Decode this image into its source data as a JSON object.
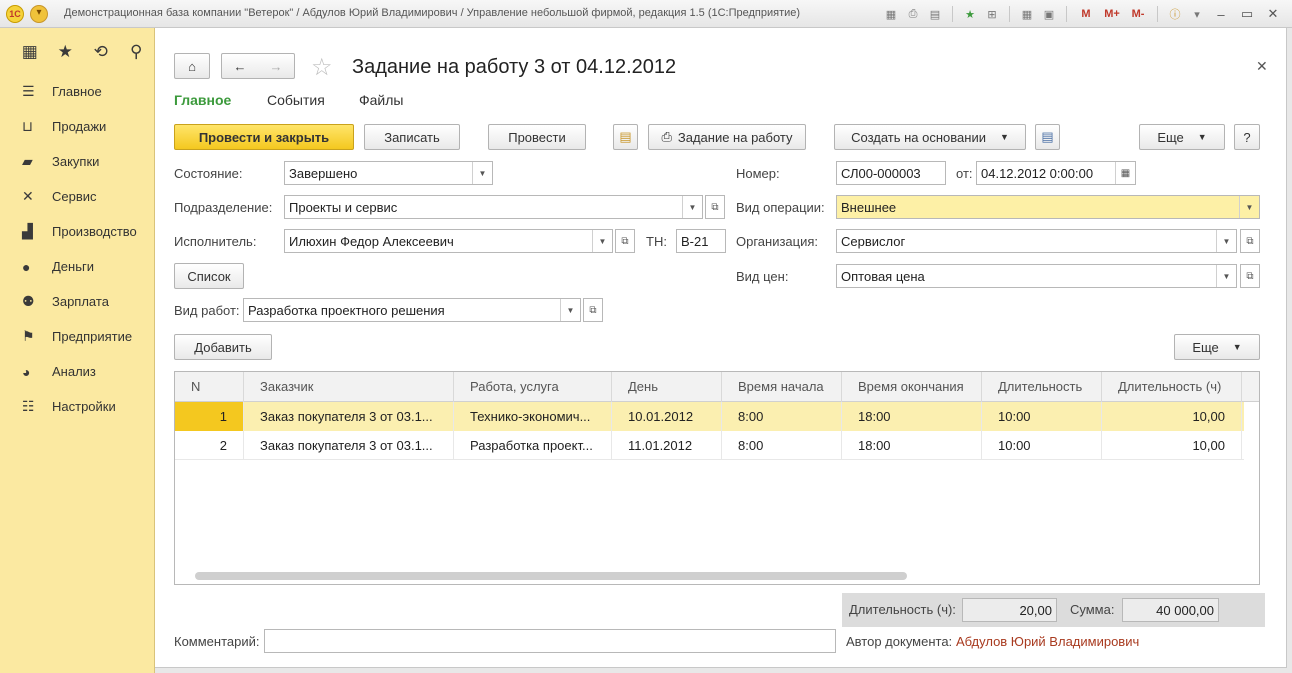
{
  "titlebar": {
    "logo": "1С",
    "title": "Демонстрационная база компании \"Ветерок\" / Абдулов Юрий Владимирович / Управление небольшой фирмой, редакция 1.5  (1С:Предприятие)",
    "tools": [
      "M",
      "M+",
      "M-"
    ]
  },
  "sidebar": {
    "items": [
      {
        "label": "Главное",
        "icon": "menu-lines-icon"
      },
      {
        "label": "Продажи",
        "icon": "basket-icon"
      },
      {
        "label": "Закупки",
        "icon": "truck-icon"
      },
      {
        "label": "Сервис",
        "icon": "tools-icon"
      },
      {
        "label": "Производство",
        "icon": "factory-icon"
      },
      {
        "label": "Деньги",
        "icon": "coin-icon"
      },
      {
        "label": "Зарплата",
        "icon": "people-icon"
      },
      {
        "label": "Предприятие",
        "icon": "flag-icon"
      },
      {
        "label": "Анализ",
        "icon": "pie-chart-icon"
      },
      {
        "label": "Настройки",
        "icon": "settings-list-icon"
      }
    ]
  },
  "doc": {
    "title": "Задание на работу 3 от 04.12.2012",
    "tabs": [
      "Главное",
      "События",
      "Файлы"
    ]
  },
  "toolbar": {
    "post_close": "Провести и закрыть",
    "save": "Записать",
    "post": "Провести",
    "print_task": "Задание на работу",
    "create_based": "Создать на основании",
    "more": "Еще",
    "help": "?"
  },
  "form": {
    "state_label": "Состояние:",
    "state_value": "Завершено",
    "division_label": "Подразделение:",
    "division_value": "Проекты и сервис",
    "executor_label": "Исполнитель:",
    "executor_value": "Илюхин Федор Алексеевич",
    "tn_label": "ТН:",
    "tn_value": "В-21",
    "list_button": "Список",
    "work_type_label": "Вид работ:",
    "work_type_value": "Разработка проектного решения",
    "number_label": "Номер:",
    "number_value": "СЛ00-000003",
    "from_label": "от:",
    "from_value": "04.12.2012  0:00:00",
    "operation_label": "Вид операции:",
    "operation_value": "Внешнее",
    "org_label": "Организация:",
    "org_value": "Сервислог",
    "price_label": "Вид цен:",
    "price_value": "Оптовая цена"
  },
  "table": {
    "add_button": "Добавить",
    "more_button": "Еще",
    "columns": [
      "N",
      "Заказчик",
      "Работа, услуга",
      "День",
      "Время начала",
      "Время окончания",
      "Длительность",
      "Длительность (ч)"
    ],
    "rows": [
      [
        "1",
        "Заказ покупателя 3 от 03.1...",
        "Технико-экономич...",
        "10.01.2012",
        "8:00",
        "18:00",
        "10:00",
        "10,00"
      ],
      [
        "2",
        "Заказ покупателя 3 от 03.1...",
        "Разработка проект...",
        "11.01.2012",
        "8:00",
        "18:00",
        "10:00",
        "10,00"
      ]
    ]
  },
  "totals": {
    "duration_label": "Длительность (ч):",
    "duration_value": "20,00",
    "sum_label": "Сумма:",
    "sum_value": "40 000,00"
  },
  "footer": {
    "comment_label": "Комментарий:",
    "comment_value": "",
    "author_label": "Автор документа:",
    "author_value": "Абдулов Юрий Владимирович"
  },
  "colors": {
    "sidebar_bg": "#fbe9a1",
    "primary_button": "#f4c81f",
    "active_tab": "#3c9a3c",
    "selected_row": "#fbefb0",
    "author_link": "#a83a1f"
  }
}
